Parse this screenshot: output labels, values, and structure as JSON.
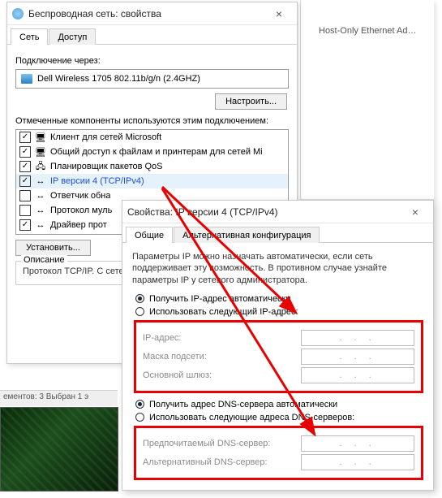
{
  "fragment": {
    "line": "Host-Only Ethernet Ad…"
  },
  "win1": {
    "title": "Беспроводная сеть: свойства",
    "tabs": {
      "network": "Сеть",
      "access": "Доступ"
    },
    "connect_via": "Подключение через:",
    "adapter": "Dell Wireless 1705 802.11b/g/n (2.4GHZ)",
    "configure": "Настроить...",
    "components_label": "Отмеченные компоненты используются этим подключением:",
    "items": [
      {
        "checked": true,
        "text": "Клиент для сетей Microsoft"
      },
      {
        "checked": true,
        "text": "Общий доступ к файлам и принтерам для сетей Mi"
      },
      {
        "checked": true,
        "text": "Планировщик пакетов QoS"
      },
      {
        "checked": true,
        "text": "IP версии 4 (TCP/IPv4)",
        "highlight": true
      },
      {
        "checked": false,
        "text": "Ответчик обна"
      },
      {
        "checked": false,
        "text": "Протокол муль"
      },
      {
        "checked": true,
        "text": "Драйвер прот"
      }
    ],
    "install": "Установить...",
    "desc_title": "Описание",
    "desc_text": "Протокол TCP/IP. С\nсетей, обеспечиваю\nвзаимодействующи"
  },
  "win2": {
    "title": "Свойства: IP версии 4 (TCP/IPv4)",
    "tabs": {
      "general": "Общие",
      "alt": "Альтернативная конфигурация"
    },
    "info": "Параметры IP можно назначать автоматически, если сеть поддерживает эту возможность. В противном случае узнайте параметры IP у сетевого администратора.",
    "radio_ip_auto": "Получить IP-адрес автоматически",
    "radio_ip_manual": "Использовать следующий IP-адрес:",
    "ip_address": "IP-адрес:",
    "subnet": "Маска подсети:",
    "gateway": "Основной шлюз:",
    "radio_dns_auto": "Получить адрес DNS-сервера автоматически",
    "radio_dns_manual": "Использовать следующие адреса DNS-серверов:",
    "dns_pref": "Предпочитаемый DNS-сервер:",
    "dns_alt": "Альтернативный DNS-сервер:",
    "ip_placeholder": ".  .  ."
  },
  "statusbar": "ементов: 3    Выбран 1 э"
}
